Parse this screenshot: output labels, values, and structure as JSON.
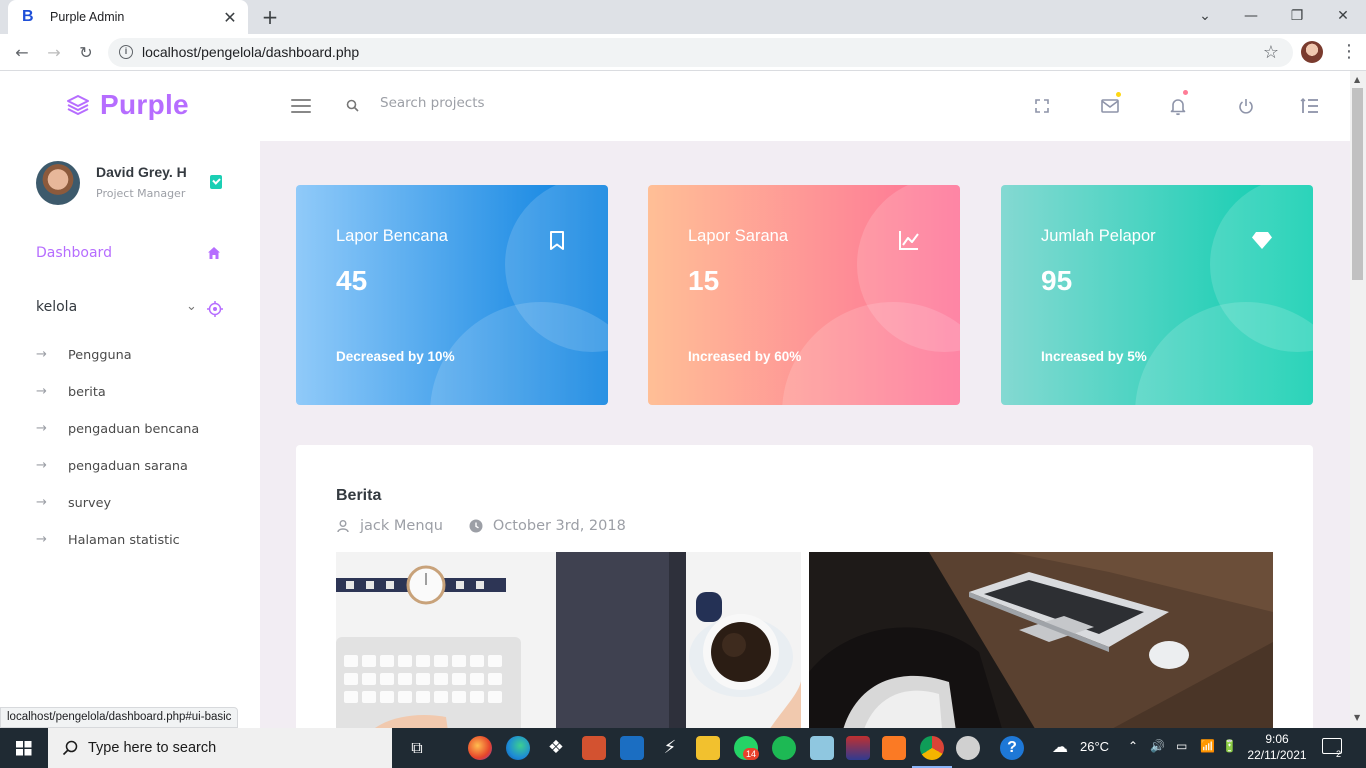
{
  "browser": {
    "tab_title": "Purple Admin",
    "tab_favicon": "B",
    "new_tab": "+",
    "url": "localhost/pengelola/dashboard.php",
    "status_url": "localhost/pengelola/dashboard.php#ui-basic"
  },
  "brand": {
    "name": "Purple",
    "color": "#b66dff"
  },
  "search": {
    "placeholder": "Search projects"
  },
  "user": {
    "name": "David Grey. H",
    "role": "Project Manager"
  },
  "sidebar": {
    "dashboard_label": "Dashboard",
    "group_label": "kelola",
    "items": [
      {
        "label": "Pengguna"
      },
      {
        "label": "berita"
      },
      {
        "label": "pengaduan bencana"
      },
      {
        "label": "pengaduan sarana"
      },
      {
        "label": "survey"
      },
      {
        "label": "Halaman statistic"
      }
    ]
  },
  "stats": [
    {
      "title": "Lapor Bencana",
      "value": "45",
      "desc": "Decreased by 10%",
      "icon": "bookmark-icon",
      "gradient": [
        "#90caf9",
        "#047edf"
      ]
    },
    {
      "title": "Lapor Sarana",
      "value": "15",
      "desc": "Increased by 60%",
      "icon": "chart-line-icon",
      "gradient": [
        "#ffbf96",
        "#fe7096"
      ]
    },
    {
      "title": "Jumlah Pelapor",
      "value": "95",
      "desc": "Increased by 5%",
      "icon": "diamond-icon",
      "gradient": [
        "#84d9d2",
        "#07cdae"
      ]
    }
  ],
  "news": {
    "title": "Berita",
    "author": "jack Menqu",
    "date": "October 3rd, 2018"
  },
  "taskbar": {
    "search_text": "Type here to search",
    "temperature": "26°C",
    "time": "9:06",
    "date": "22/11/2021",
    "whatsapp_badge": "14",
    "notification_count": "2"
  }
}
